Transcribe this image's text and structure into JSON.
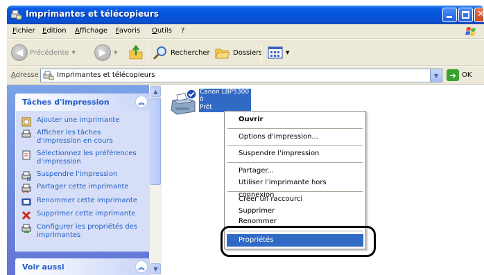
{
  "window": {
    "title": "Imprimantes et télécopieurs",
    "controls": [
      "minimize",
      "maximize",
      "close"
    ]
  },
  "menu": {
    "items": [
      "Fichier",
      "Edition",
      "Affichage",
      "Favoris",
      "Outils",
      "?"
    ]
  },
  "toolbar": {
    "back_label": "Précédente",
    "search_label": "Rechercher",
    "folders_label": "Dossiers"
  },
  "address": {
    "label": "Adresse",
    "value": "Imprimantes et télécopieurs",
    "go_label": "OK"
  },
  "taskpane": {
    "print_tasks": {
      "title": "Tâches d'impression",
      "items": [
        {
          "label": "Ajouter une imprimante",
          "icon": "add-printer-icon"
        },
        {
          "label": "Afficher les tâches d'impression en cours",
          "icon": "view-print-jobs-icon"
        },
        {
          "label": "Sélectionnez les préférences d'impression",
          "icon": "preferences-icon"
        },
        {
          "label": "Suspendre l'impression",
          "icon": "pause-printing-icon"
        },
        {
          "label": "Partager cette imprimante",
          "icon": "share-printer-icon"
        },
        {
          "label": "Renommer cette imprimante",
          "icon": "rename-printer-icon"
        },
        {
          "label": "Supprimer cette imprimante",
          "icon": "delete-icon"
        },
        {
          "label": "Configurer les propriétés des imprimantes",
          "icon": "properties-icon"
        }
      ]
    },
    "see_also": {
      "title": "Voir aussi"
    }
  },
  "printer": {
    "name": "Canon LBP5300",
    "jobs": "0",
    "status": "Prêt"
  },
  "context_menu": {
    "items": [
      {
        "label": "Ouvrir",
        "bold": true
      },
      {
        "label": "Options d'impression..."
      },
      {
        "label": "Suspendre l'impression"
      },
      {
        "label": "Partager..."
      },
      {
        "label": "Utiliser l'imprimante hors connexion"
      },
      {
        "label": "Créer un raccourci"
      },
      {
        "label": "Supprimer"
      },
      {
        "label": "Renommer"
      },
      {
        "label": "Propriétés",
        "selected": true
      }
    ]
  },
  "colors": {
    "titlebar": "#0553db",
    "selection": "#316ac5",
    "task_link": "#215dc6",
    "taskpane_bg": "#7ba2e7"
  }
}
